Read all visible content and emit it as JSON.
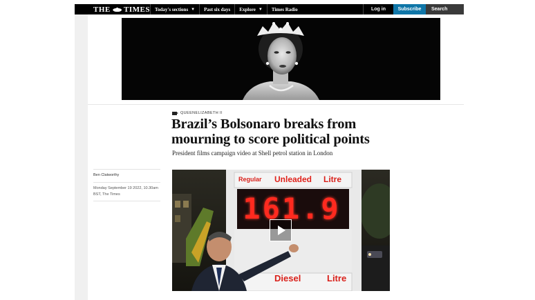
{
  "nav": {
    "logo": "THE TIMES",
    "items": [
      {
        "label": "Today's sections",
        "has_chevron": true
      },
      {
        "label": "Past six days",
        "has_chevron": false
      },
      {
        "label": "Explore",
        "has_chevron": true
      },
      {
        "label": "Times Radio",
        "has_chevron": false
      }
    ],
    "login": "Log in",
    "subscribe": "Subscribe",
    "search": "Search"
  },
  "article": {
    "kicker": "QUEENELIZABETH II",
    "headline": "Brazil’s Bolsonaro breaks from mourning to score political points",
    "standfirst": "President films campaign video at Shell petrol station in London",
    "author": "Ben Clatworthy",
    "date": "Monday September 19 2022, 10.30am BST, The Times"
  },
  "video": {
    "sign_top": {
      "left": "Regular",
      "middle": "Unleaded",
      "right": "Litre"
    },
    "price": "161.9",
    "sign_bottom": {
      "left": "Diesel",
      "right": "Litre"
    }
  },
  "colors": {
    "nav_bg": "#000000",
    "subscribe_bg": "#0f76a8",
    "search_bg": "#3a3a3a",
    "price_led": "#ff2a1f",
    "sign_text": "#d9201a"
  },
  "icons": {
    "kicker": "video-camera-icon",
    "video_control": "play-icon"
  }
}
